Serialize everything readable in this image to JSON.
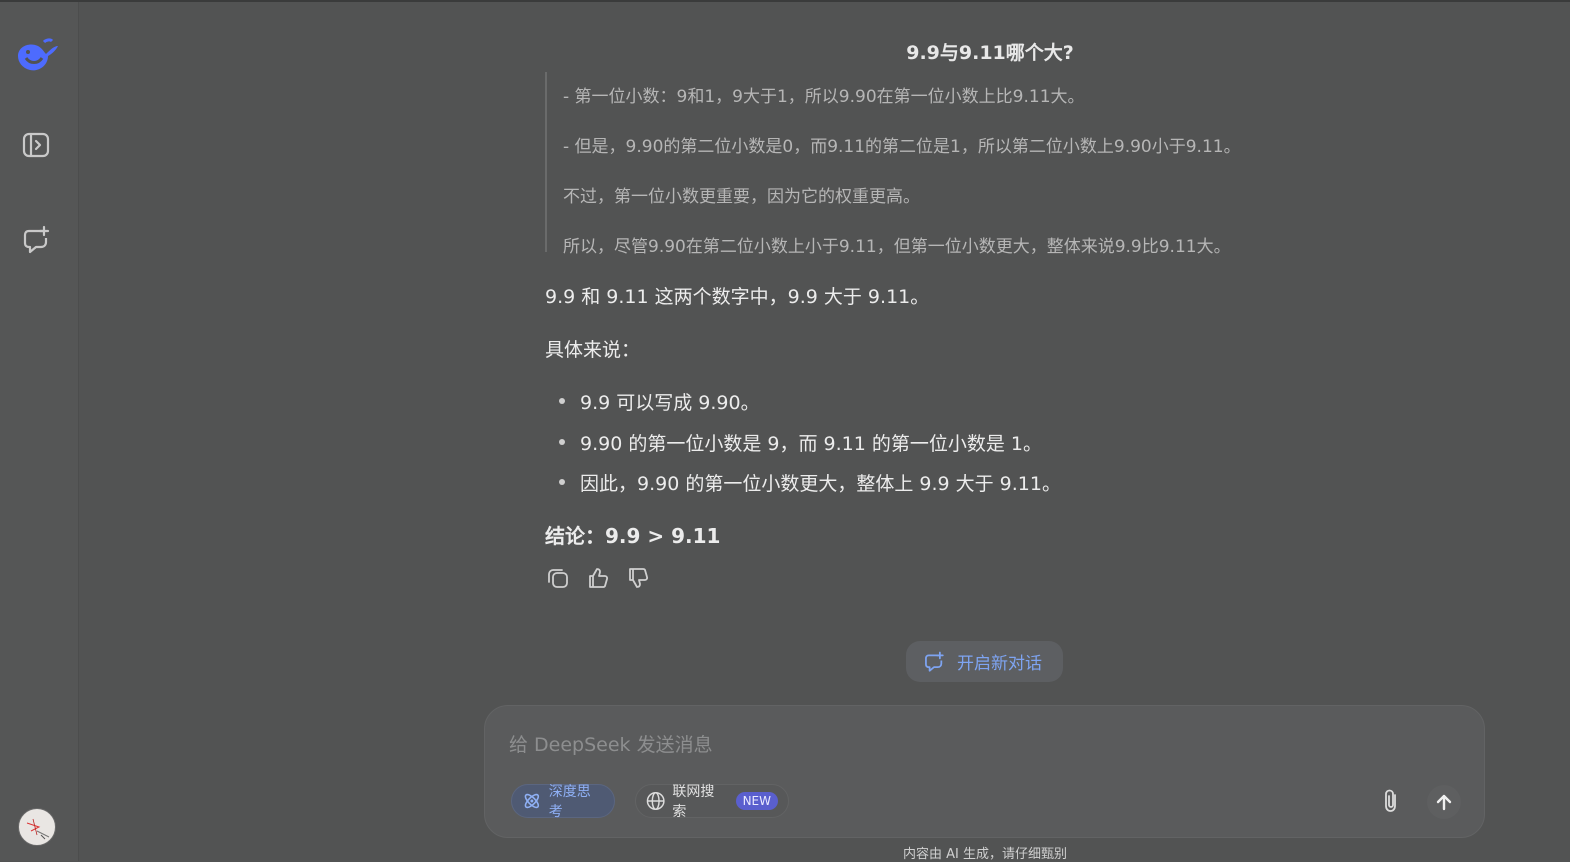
{
  "conversation": {
    "title": "9.9与9.11哪个大?",
    "thinking_lines": [
      "- 第一位小数：9和1，9大于1，所以9.90在第一位小数上比9.11大。",
      "- 但是，9.90的第二位小数是0，而9.11的第二位是1，所以第二位小数上9.90小于9.11。",
      "不过，第一位小数更重要，因为它的权重更高。",
      "所以，尽管9.90在第二位小数上小于9.11，但第一位小数更大，整体来说9.9比9.11大。"
    ],
    "answer_intro": "9.9 和 9.11 这两个数字中，9.9 大于 9.11。",
    "answer_detail_label": "具体来说：",
    "bullets": [
      "9.9 可以写成 9.90。",
      "9.90 的第一位小数是 9，而 9.11 的第一位小数是 1。",
      "因此，9.90 的第一位小数更大，整体上 9.9 大于 9.11。"
    ],
    "conclusion": "结论：9.9 > 9.11"
  },
  "new_chat": {
    "label": "开启新对话"
  },
  "composer": {
    "placeholder": "给 DeepSeek 发送消息",
    "value": "",
    "deep_think_label": "深度思考",
    "web_search_label": "联网搜索",
    "web_search_badge": "NEW"
  },
  "footer": {
    "note": "内容由 AI 生成，请仔细甄别"
  },
  "icons": {
    "logo": "deepseek-whale-icon",
    "sidebar_toggle": "sidebar-toggle-icon",
    "new_chat": "new-chat-icon",
    "copy": "copy-icon",
    "like": "thumbs-up-icon",
    "dislike": "thumbs-down-icon",
    "deep_think": "atom-icon",
    "web_search": "globe-icon",
    "attach": "paperclip-icon",
    "send": "arrow-up-icon"
  },
  "colors": {
    "accent": "#7ea4f2",
    "logo": "#4d6bfe",
    "background": "#525353",
    "badge": "#5a5fce"
  }
}
